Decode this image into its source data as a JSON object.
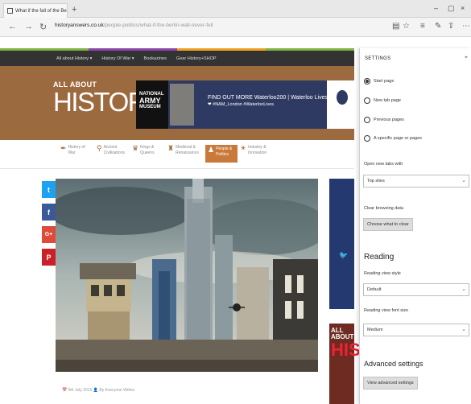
{
  "browser": {
    "tab_title": "What if the fall of the Be",
    "tab_close": "×",
    "new_tab": "+",
    "url_host": "historyanswers.co.uk",
    "url_rest": "/people-politics/what-if-the-berlin-wall-never-fell",
    "window_controls": [
      "–",
      "▢",
      "×"
    ]
  },
  "site": {
    "nav_items": [
      "All about History ▾",
      "History Of War ▾",
      "Bookazines",
      "Gear History+SHOP"
    ],
    "logo_line1": "ALL ABOUT",
    "logo_line2": "HISTORY",
    "banner": {
      "museum_line1": "NATIONAL",
      "museum_line2": "ARMY",
      "museum_line3": "MUSEUM",
      "text1": "FIND OUT MORE   Waterloo200 | Waterloo Lives",
      "text2": "❤ #NAM_London  #WaterlooLives"
    },
    "categories": [
      {
        "label": "History of War"
      },
      {
        "label": "Ancient Civilisations"
      },
      {
        "label": "Kings & Queens"
      },
      {
        "label": "Medieval & Renaissance"
      },
      {
        "label": "People & Politics"
      },
      {
        "label": "Industry & Innovation"
      }
    ],
    "social": [
      "t",
      "f",
      "G+",
      "P"
    ],
    "caption": "📅 5th July 2015   👤 By Everyone Writes",
    "side_mag_title": "ALL ABOUT",
    "side_mag_big": "HIS"
  },
  "settings": {
    "title": "SETTINGS",
    "pin": "⌖",
    "open_with": [
      {
        "label": "Start page",
        "selected": true
      },
      {
        "label": "New tab page",
        "selected": false
      },
      {
        "label": "Previous pages",
        "selected": false
      },
      {
        "label": "A specific page or pages",
        "selected": false
      }
    ],
    "open_new_tabs_label": "Open new tabs with",
    "open_new_tabs_value": "Top sites",
    "clear_label": "Clear browsing data",
    "clear_button": "Choose what to clear",
    "reading_heading": "Reading",
    "reading_style_label": "Reading view style",
    "reading_style_value": "Default",
    "reading_font_label": "Reading view font size",
    "reading_font_value": "Medium",
    "advanced_heading": "Advanced settings",
    "advanced_button": "View advanced settings"
  },
  "colors": {
    "brand_brown": "#9c6a3f",
    "nav_dark": "#333333",
    "active_category": "#c97a3b",
    "twitter": "#1da1f2",
    "facebook": "#3b5998",
    "google_plus": "#dd4b39",
    "pinterest": "#cb2027"
  }
}
